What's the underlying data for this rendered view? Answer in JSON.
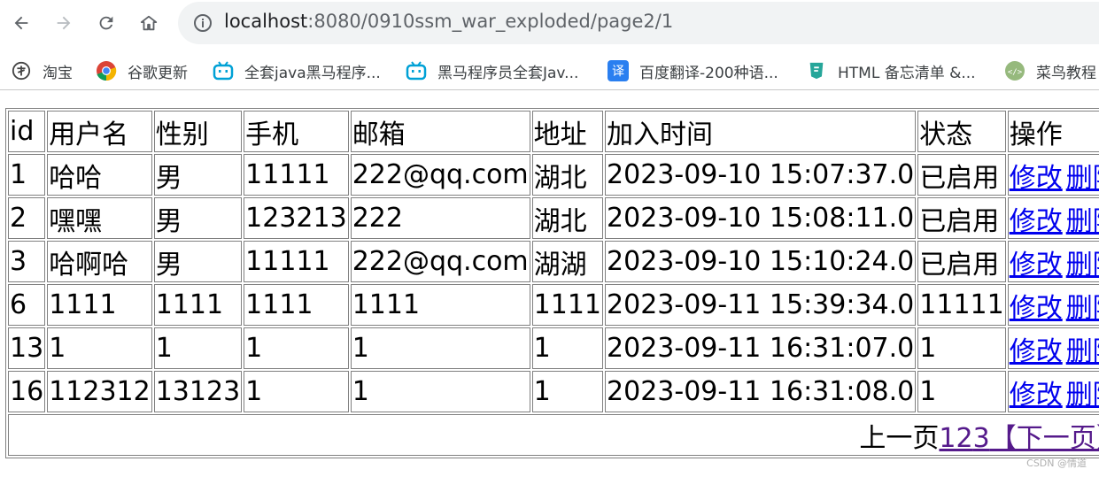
{
  "browser": {
    "url_host": "localhost",
    "url_rest": ":8080/0910ssm_war_exploded/page2/1",
    "bookmarks": [
      {
        "label": "淘宝",
        "icon": "taobao-icon"
      },
      {
        "label": "谷歌更新",
        "icon": "chrome-icon"
      },
      {
        "label": "全套java黑马程序...",
        "icon": "bilibili-icon"
      },
      {
        "label": "黑马程序员全套Jav...",
        "icon": "bilibili-icon"
      },
      {
        "label": "百度翻译-200种语...",
        "icon": "translate-icon"
      },
      {
        "label": "HTML 备忘清单 &...",
        "icon": "html-icon"
      },
      {
        "label": "菜鸟教程",
        "icon": "runoob-icon"
      }
    ]
  },
  "table": {
    "headers": [
      "id",
      "用户名",
      "性别",
      "手机",
      "邮箱",
      "地址",
      "加入时间",
      "状态",
      "操作"
    ],
    "rows": [
      [
        "1",
        "哈哈",
        "男",
        "11111",
        "222@qq.com",
        "湖北",
        "2023-09-10 15:07:37.0",
        "已启用"
      ],
      [
        "2",
        "嘿嘿",
        "男",
        "123213",
        "222",
        "湖北",
        "2023-09-10 15:08:11.0",
        "已启用"
      ],
      [
        "3",
        "哈啊哈",
        "男",
        "11111",
        "222@qq.com",
        "湖湖",
        "2023-09-10 15:10:24.0",
        "已启用"
      ],
      [
        "6",
        "1111",
        "1111",
        "1111",
        "1111",
        "1111",
        "2023-09-11 15:39:34.0",
        "11111"
      ],
      [
        "13",
        "1",
        "1",
        "1",
        "1",
        "1",
        "2023-09-11 16:31:07.0",
        "1"
      ],
      [
        "16",
        "112312",
        "13123",
        "1",
        "1",
        "1",
        "2023-09-11 16:31:08.0",
        "1"
      ]
    ],
    "edit_label": "修改",
    "delete_label": "删除"
  },
  "pager": {
    "prev_label": "上一页",
    "pages": [
      "1",
      "2",
      "3"
    ],
    "next_label": "【下一页】"
  },
  "watermark": "CSDN @情道"
}
